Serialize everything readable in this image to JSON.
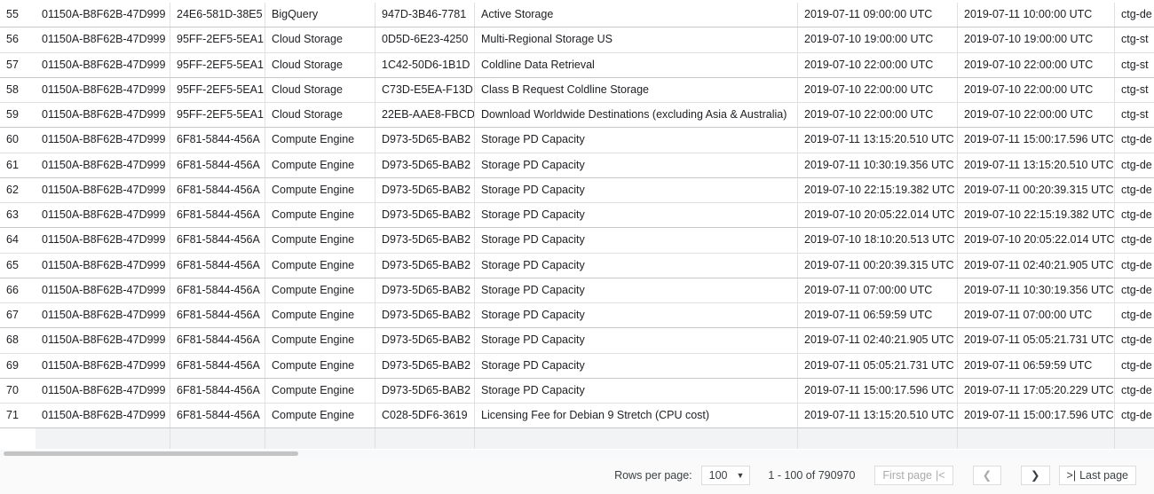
{
  "rows": [
    [
      "55",
      "01150A-B8F62B-47D999",
      "24E6-581D-38E5",
      "BigQuery",
      "947D-3B46-7781",
      "Active Storage",
      "2019-07-11 09:00:00 UTC",
      "2019-07-11 10:00:00 UTC",
      "ctg-de"
    ],
    [
      "56",
      "01150A-B8F62B-47D999",
      "95FF-2EF5-5EA1",
      "Cloud Storage",
      "0D5D-6E23-4250",
      "Multi-Regional Storage US",
      "2019-07-10 19:00:00 UTC",
      "2019-07-10 19:00:00 UTC",
      "ctg-st"
    ],
    [
      "57",
      "01150A-B8F62B-47D999",
      "95FF-2EF5-5EA1",
      "Cloud Storage",
      "1C42-50D6-1B1D",
      "Coldline Data Retrieval",
      "2019-07-10 22:00:00 UTC",
      "2019-07-10 22:00:00 UTC",
      "ctg-st"
    ],
    [
      "58",
      "01150A-B8F62B-47D999",
      "95FF-2EF5-5EA1",
      "Cloud Storage",
      "C73D-E5EA-F13D",
      "Class B Request Coldline Storage",
      "2019-07-10 22:00:00 UTC",
      "2019-07-10 22:00:00 UTC",
      "ctg-st"
    ],
    [
      "59",
      "01150A-B8F62B-47D999",
      "95FF-2EF5-5EA1",
      "Cloud Storage",
      "22EB-AAE8-FBCD",
      "Download Worldwide Destinations (excluding Asia & Australia)",
      "2019-07-10 22:00:00 UTC",
      "2019-07-10 22:00:00 UTC",
      "ctg-st"
    ],
    [
      "60",
      "01150A-B8F62B-47D999",
      "6F81-5844-456A",
      "Compute Engine",
      "D973-5D65-BAB2",
      "Storage PD Capacity",
      "2019-07-11 13:15:20.510 UTC",
      "2019-07-11 15:00:17.596 UTC",
      "ctg-de"
    ],
    [
      "61",
      "01150A-B8F62B-47D999",
      "6F81-5844-456A",
      "Compute Engine",
      "D973-5D65-BAB2",
      "Storage PD Capacity",
      "2019-07-11 10:30:19.356 UTC",
      "2019-07-11 13:15:20.510 UTC",
      "ctg-de"
    ],
    [
      "62",
      "01150A-B8F62B-47D999",
      "6F81-5844-456A",
      "Compute Engine",
      "D973-5D65-BAB2",
      "Storage PD Capacity",
      "2019-07-10 22:15:19.382 UTC",
      "2019-07-11 00:20:39.315 UTC",
      "ctg-de"
    ],
    [
      "63",
      "01150A-B8F62B-47D999",
      "6F81-5844-456A",
      "Compute Engine",
      "D973-5D65-BAB2",
      "Storage PD Capacity",
      "2019-07-10 20:05:22.014 UTC",
      "2019-07-10 22:15:19.382 UTC",
      "ctg-de"
    ],
    [
      "64",
      "01150A-B8F62B-47D999",
      "6F81-5844-456A",
      "Compute Engine",
      "D973-5D65-BAB2",
      "Storage PD Capacity",
      "2019-07-10 18:10:20.513 UTC",
      "2019-07-10 20:05:22.014 UTC",
      "ctg-de"
    ],
    [
      "65",
      "01150A-B8F62B-47D999",
      "6F81-5844-456A",
      "Compute Engine",
      "D973-5D65-BAB2",
      "Storage PD Capacity",
      "2019-07-11 00:20:39.315 UTC",
      "2019-07-11 02:40:21.905 UTC",
      "ctg-de"
    ],
    [
      "66",
      "01150A-B8F62B-47D999",
      "6F81-5844-456A",
      "Compute Engine",
      "D973-5D65-BAB2",
      "Storage PD Capacity",
      "2019-07-11 07:00:00 UTC",
      "2019-07-11 10:30:19.356 UTC",
      "ctg-de"
    ],
    [
      "67",
      "01150A-B8F62B-47D999",
      "6F81-5844-456A",
      "Compute Engine",
      "D973-5D65-BAB2",
      "Storage PD Capacity",
      "2019-07-11 06:59:59 UTC",
      "2019-07-11 07:00:00 UTC",
      "ctg-de"
    ],
    [
      "68",
      "01150A-B8F62B-47D999",
      "6F81-5844-456A",
      "Compute Engine",
      "D973-5D65-BAB2",
      "Storage PD Capacity",
      "2019-07-11 02:40:21.905 UTC",
      "2019-07-11 05:05:21.731 UTC",
      "ctg-de"
    ],
    [
      "69",
      "01150A-B8F62B-47D999",
      "6F81-5844-456A",
      "Compute Engine",
      "D973-5D65-BAB2",
      "Storage PD Capacity",
      "2019-07-11 05:05:21.731 UTC",
      "2019-07-11 06:59:59 UTC",
      "ctg-de"
    ],
    [
      "70",
      "01150A-B8F62B-47D999",
      "6F81-5844-456A",
      "Compute Engine",
      "D973-5D65-BAB2",
      "Storage PD Capacity",
      "2019-07-11 15:00:17.596 UTC",
      "2019-07-11 17:05:20.229 UTC",
      "ctg-de"
    ],
    [
      "71",
      "01150A-B8F62B-47D999",
      "6F81-5844-456A",
      "Compute Engine",
      "C028-5DF6-3619",
      "Licensing Fee for Debian 9 Stretch (CPU cost)",
      "2019-07-11 13:15:20.510 UTC",
      "2019-07-11 15:00:17.596 UTC",
      "ctg-de"
    ]
  ],
  "footer": {
    "rows_per_page_label": "Rows per page:",
    "rows_per_page_value": "100",
    "range": "1 - 100 of 790970",
    "first_page": "First page",
    "last_page": "Last page"
  }
}
